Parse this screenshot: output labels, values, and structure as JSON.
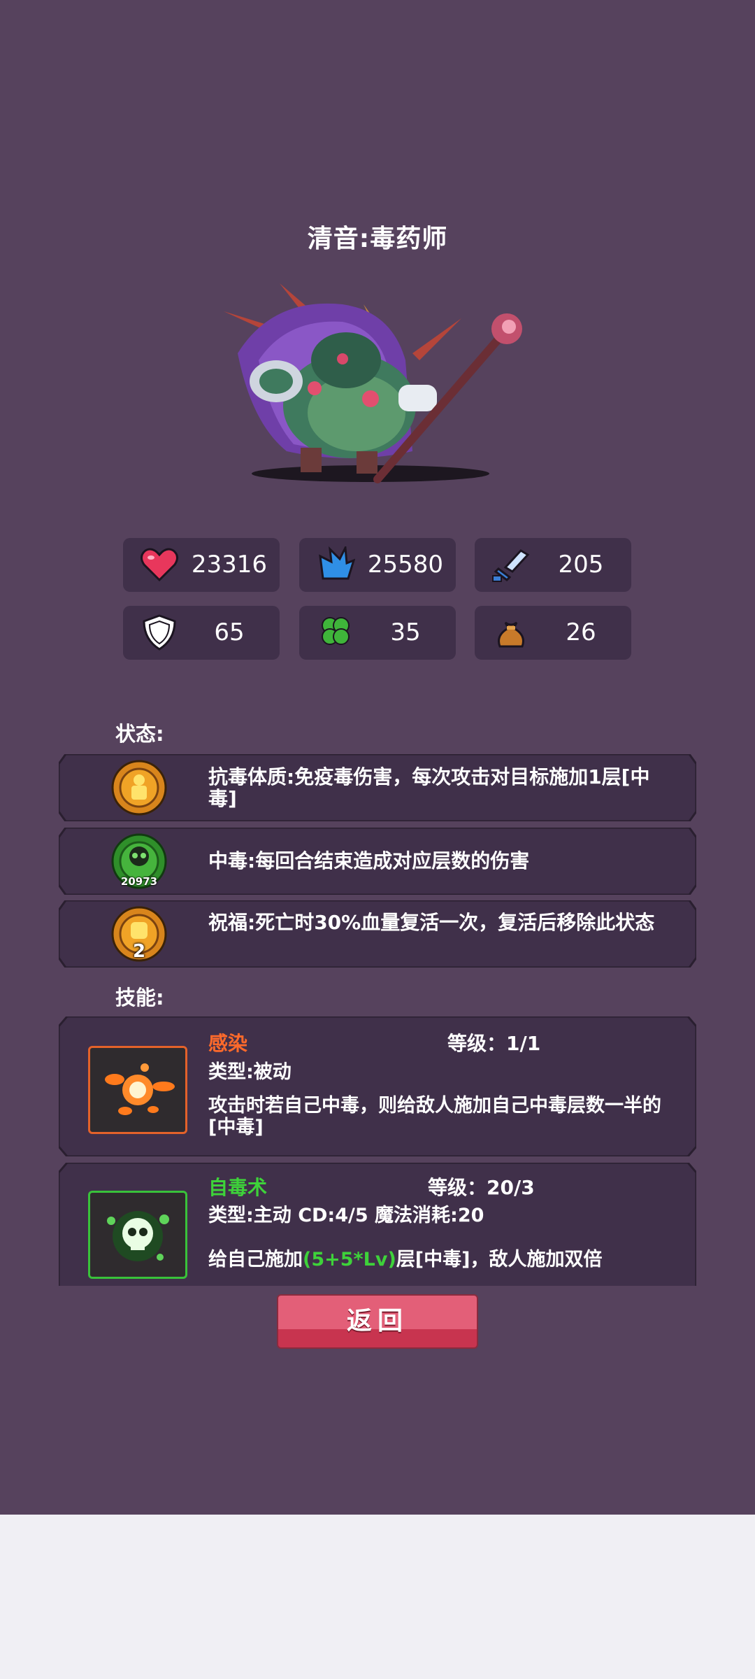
{
  "header": {
    "title": "清音:毒药师"
  },
  "stats": [
    {
      "icon": "heart-icon",
      "value": "23316"
    },
    {
      "icon": "mana-icon",
      "value": "25580"
    },
    {
      "icon": "sword-icon",
      "value": "205"
    },
    {
      "icon": "shield-icon",
      "value": "65"
    },
    {
      "icon": "clover-icon",
      "value": "35"
    },
    {
      "icon": "money-bag-icon",
      "value": "26"
    }
  ],
  "status_section": {
    "label": "状态:",
    "items": [
      {
        "icon": "poison-resist-icon",
        "text": "抗毒体质:免疫毒伤害，每次攻击对目标施加1层[中毒]",
        "count": ""
      },
      {
        "icon": "poison-skull-icon",
        "text": "中毒:每回合结束造成对应层数的伤害",
        "count": "20973"
      },
      {
        "icon": "blessing-fist-icon",
        "text": "祝福:死亡时30%血量复活一次，复活后移除此状态",
        "count": "2"
      }
    ]
  },
  "skills_section": {
    "label": "技能:",
    "items": [
      {
        "icon": "infect-splash-icon",
        "name": "感染",
        "name_color": "#ff6a2b",
        "level": "等级：1/1",
        "type": "类型:被动",
        "desc": "攻击时若自己中毒，则给敌人施加自己中毒层数一半的[中毒]"
      },
      {
        "icon": "self-poison-skull-icon",
        "name": "自毒术",
        "name_color": "#3ed23a",
        "level": "等级：20/3",
        "type": "类型:主动  CD:4/5  魔法消耗:20",
        "desc_prefix": "给自己施加",
        "desc_highlight": "(5+5*Lv)",
        "desc_suffix": "层[中毒]，敌人施加双倍"
      }
    ]
  },
  "back_button": {
    "label": "返回"
  },
  "colors": {
    "background": "#56425d",
    "panel": "#40304a",
    "button": "#e35f78",
    "highlight_green": "#3ed23a"
  }
}
